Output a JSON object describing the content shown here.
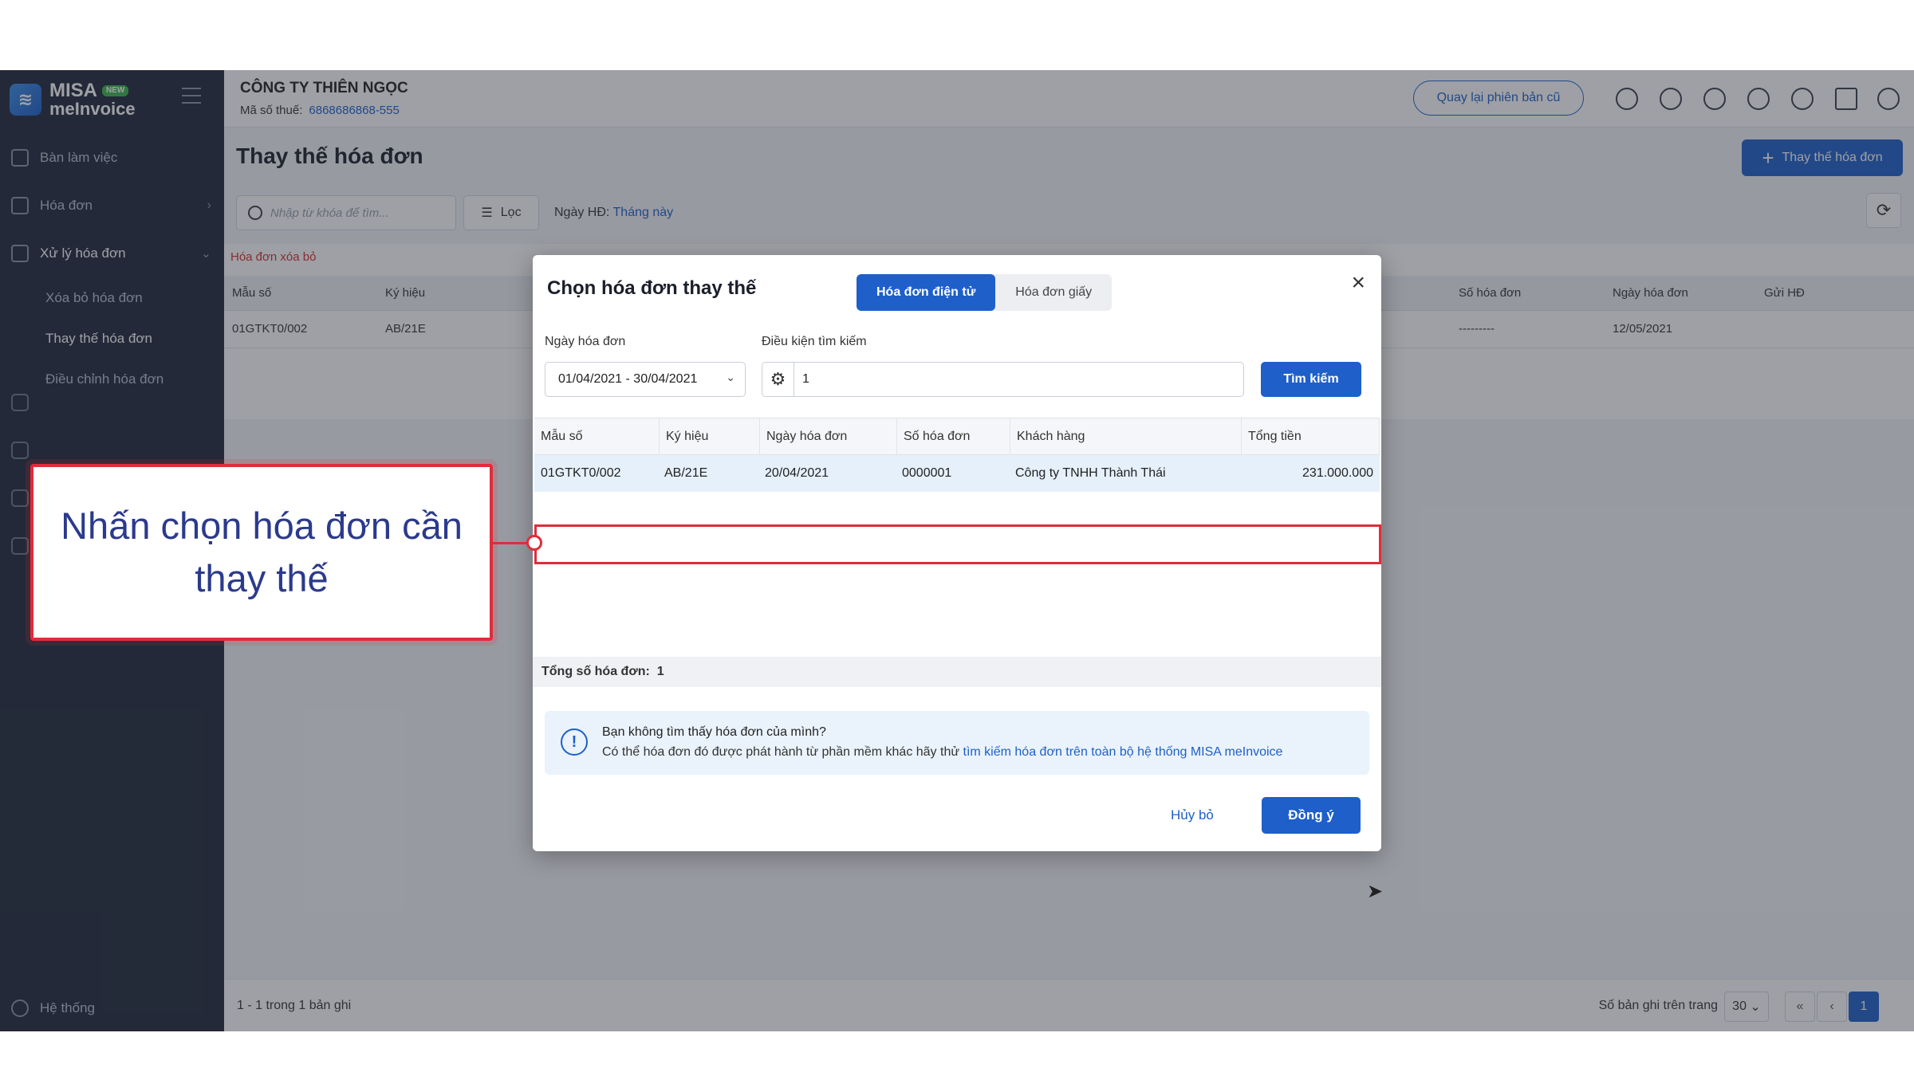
{
  "sidebar": {
    "logo_line1": "MISA",
    "logo_badge": "NEW",
    "logo_line2": "meInvoice",
    "items": [
      {
        "label": "Bàn làm việc"
      },
      {
        "label": "Hóa đơn"
      },
      {
        "label": "Xử lý hóa đơn"
      }
    ],
    "sub_items": [
      {
        "label": "Xóa bỏ hóa đơn"
      },
      {
        "label": "Thay thế hóa đơn"
      },
      {
        "label": "Điều chỉnh hóa đơn"
      }
    ],
    "system_label": "Hệ thống"
  },
  "header": {
    "company": "CÔNG TY THIÊN NGỌC",
    "tax_label": "Mã số thuế:",
    "tax_value": "6868686868-555",
    "old_version": "Quay lại phiên bản cũ"
  },
  "page": {
    "title": "Thay thế hóa đơn",
    "add_button": "Thay thế hóa đơn",
    "search_placeholder": "Nhập từ khóa để tìm...",
    "filter_label": "Lọc",
    "date_label": "Ngày HĐ:",
    "date_value": "Tháng này",
    "deleted_label": "Hóa đơn xóa bỏ",
    "columns": [
      "Mẫu số",
      "Ký hiệu",
      "Số hóa đơn",
      "Ngày hóa đơn",
      "Gửi HĐ"
    ],
    "row": {
      "mau_so": "01GTKT0/002",
      "ky_hieu": "AB/21E",
      "so_hd": "---------",
      "ngay_hd": "12/05/2021"
    },
    "record_info": "1 - 1 trong 1 bản ghi",
    "per_page_label": "Số bản ghi trên trang",
    "per_page_value": "30",
    "current_page": "1"
  },
  "dialog": {
    "title": "Chọn hóa đơn thay thế",
    "tab_electronic": "Hóa đơn điện tử",
    "tab_paper": "Hóa đơn giấy",
    "date_label": "Ngày hóa đơn",
    "date_value": "01/04/2021 - 30/04/2021",
    "condition_label": "Điều kiện tìm kiếm",
    "condition_value": "1",
    "search_button": "Tìm kiếm",
    "columns": [
      "Mẫu số",
      "Ký hiệu",
      "Ngày hóa đơn",
      "Số hóa đơn",
      "Khách hàng",
      "Tổng tiền"
    ],
    "row": {
      "mau_so": "01GTKT0/002",
      "ky_hieu": "AB/21E",
      "ngay": "20/04/2021",
      "so": "0000001",
      "khach_hang": "Công ty TNHH Thành Thái",
      "tong_tien": "231.000.000"
    },
    "total_label": "Tổng số hóa đơn:",
    "total_value": "1",
    "notice_title": "Bạn không tìm thấy hóa đơn của mình?",
    "notice_text": "Có thể hóa đơn đó được phát hành từ phần mềm khác hãy thử",
    "notice_link": "tìm kiếm hóa đơn trên toàn bộ hệ thống MISA meInvoice",
    "cancel_button": "Hủy bỏ",
    "ok_button": "Đồng ý"
  },
  "callout": {
    "text": "Nhấn chọn hóa đơn cần thay thế"
  },
  "colors": {
    "primary": "#1e5fc9",
    "sidebar": "#1f2739",
    "highlight": "#e12c3a"
  }
}
